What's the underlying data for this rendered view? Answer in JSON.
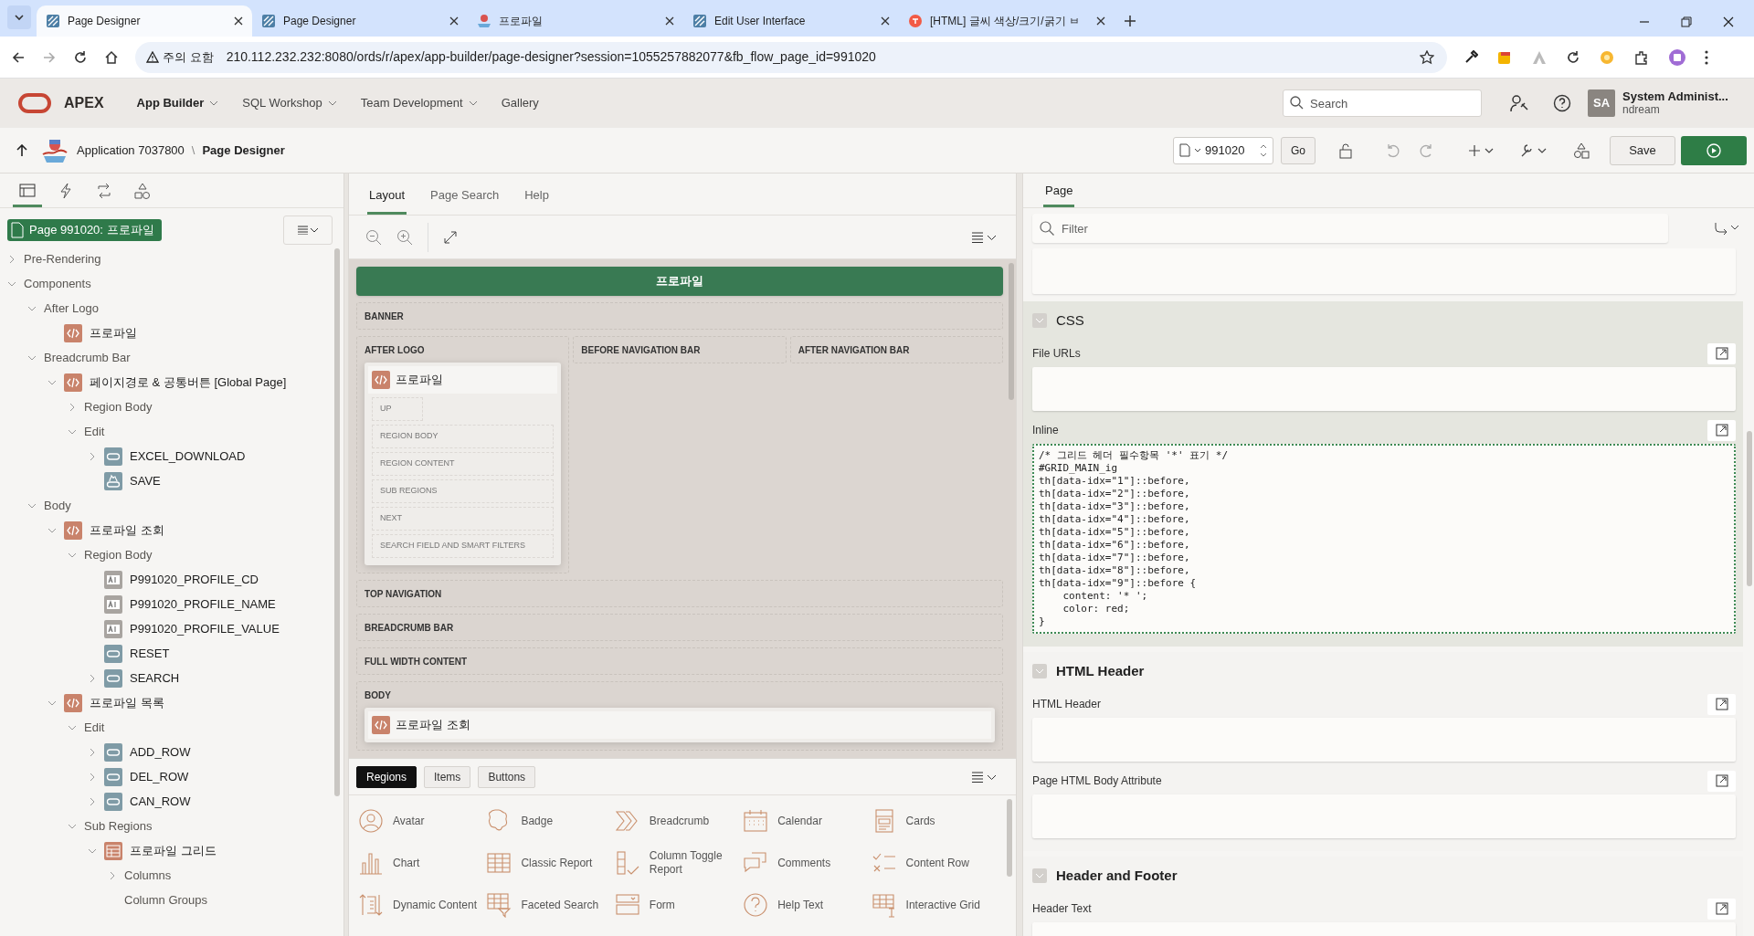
{
  "browser": {
    "tabs": [
      {
        "title": "Page Designer",
        "selected": true,
        "kind": "apex"
      },
      {
        "title": "Page Designer",
        "selected": false,
        "kind": "apex"
      },
      {
        "title": "프로파일",
        "selected": false,
        "kind": "app"
      },
      {
        "title": "Edit User Interface",
        "selected": false,
        "kind": "apex"
      },
      {
        "title": "[HTML] 글씨 색상/크기/굵기 ㅂ",
        "selected": false,
        "kind": "blog"
      }
    ],
    "security_label": "주의 요함",
    "url": "210.112.232.232:8080/ords/r/apex/app-builder/page-designer?session=1055257882077&fb_flow_page_id=991020"
  },
  "app_header": {
    "logo": "APEX",
    "nav": [
      {
        "label": "App Builder",
        "current": true
      },
      {
        "label": "SQL Workshop",
        "current": false
      },
      {
        "label": "Team Development",
        "current": false
      },
      {
        "label": "Gallery",
        "current": false
      }
    ],
    "search": {
      "placeholder": "Search"
    },
    "user": {
      "initials": "SA",
      "name": "System Administ...",
      "workspace": "ndream"
    }
  },
  "toolbar": {
    "application": "Application 7037800",
    "separator": "\\",
    "page_designer": "Page Designer",
    "page_number": "991020",
    "go": "Go",
    "save": "Save"
  },
  "left_panel": {
    "tabs": [
      {
        "selected": true
      },
      {
        "selected": false
      },
      {
        "selected": false
      },
      {
        "selected": false
      }
    ],
    "page_badge": "Page 991020: 프로파일",
    "tree": [
      {
        "label": "Pre-Rendering",
        "kind": "folder",
        "expanded": false
      },
      {
        "label": "Components",
        "kind": "folder",
        "expanded": true,
        "children": [
          {
            "label": "After Logo",
            "kind": "folder",
            "expanded": true,
            "children": [
              {
                "label": "프로파일",
                "kind": "region"
              }
            ]
          },
          {
            "label": "Breadcrumb Bar",
            "kind": "folder",
            "expanded": true,
            "children": [
              {
                "label": "페이지경로 & 공통버튼 [Global Page]",
                "kind": "region",
                "expanded": true,
                "children": [
                  {
                    "label": "Region Body",
                    "kind": "folder",
                    "expanded": false
                  },
                  {
                    "label": "Edit",
                    "kind": "folder",
                    "expanded": true,
                    "children": [
                      {
                        "label": "EXCEL_DOWNLOAD",
                        "kind": "button",
                        "expanded": false
                      },
                      {
                        "label": "SAVE",
                        "kind": "hot_button"
                      }
                    ]
                  }
                ]
              }
            ]
          },
          {
            "label": "Body",
            "kind": "folder",
            "expanded": true,
            "children": [
              {
                "label": "프로파일 조회",
                "kind": "region",
                "expanded": true,
                "children": [
                  {
                    "label": "Region Body",
                    "kind": "folder",
                    "expanded": true,
                    "children": [
                      {
                        "label": "P991020_PROFILE_CD",
                        "kind": "item"
                      },
                      {
                        "label": "P991020_PROFILE_NAME",
                        "kind": "item"
                      },
                      {
                        "label": "P991020_PROFILE_VALUE",
                        "kind": "item"
                      },
                      {
                        "label": "RESET",
                        "kind": "button"
                      },
                      {
                        "label": "SEARCH",
                        "kind": "button",
                        "expanded": false
                      }
                    ]
                  }
                ]
              },
              {
                "label": "프로파일 목록",
                "kind": "region",
                "expanded": true,
                "children": [
                  {
                    "label": "Edit",
                    "kind": "folder",
                    "expanded": true,
                    "children": [
                      {
                        "label": "ADD_ROW",
                        "kind": "button",
                        "expanded": false
                      },
                      {
                        "label": "DEL_ROW",
                        "kind": "button",
                        "expanded": false
                      },
                      {
                        "label": "CAN_ROW",
                        "kind": "button",
                        "expanded": false
                      }
                    ]
                  },
                  {
                    "label": "Sub Regions",
                    "kind": "folder",
                    "expanded": true,
                    "children": [
                      {
                        "label": "프로파일 그리드",
                        "kind": "grid",
                        "expanded": true,
                        "children": [
                          {
                            "label": "Columns",
                            "kind": "folder",
                            "expanded": false
                          },
                          {
                            "label": "Column Groups",
                            "kind": "folder"
                          }
                        ]
                      }
                    ]
                  }
                ]
              }
            ]
          }
        ]
      }
    ]
  },
  "layout_panel": {
    "tabs": [
      {
        "label": "Layout",
        "selected": true
      },
      {
        "label": "Page Search",
        "selected": false
      },
      {
        "label": "Help",
        "selected": false
      }
    ],
    "page_title": "프로파일",
    "positions": [
      {
        "kind": "full",
        "label": "BANNER"
      },
      {
        "kind": "row",
        "columns": [
          {
            "label": "AFTER LOGO",
            "region": {
              "title": "프로파일",
              "slots": [
                "UP",
                "REGION BODY",
                "REGION CONTENT",
                "SUB REGIONS",
                "NEXT",
                "SEARCH FIELD AND SMART FILTERS"
              ]
            }
          },
          {
            "label": "BEFORE NAVIGATION BAR"
          },
          {
            "label": "AFTER NAVIGATION BAR"
          }
        ]
      },
      {
        "kind": "full",
        "label": "TOP NAVIGATION"
      },
      {
        "kind": "full",
        "label": "BREADCRUMB BAR"
      },
      {
        "kind": "full",
        "label": "FULL WIDTH CONTENT"
      },
      {
        "kind": "full",
        "label": "BODY",
        "region": {
          "title": "프로파일 조회"
        }
      }
    ]
  },
  "gallery": {
    "tabs": [
      {
        "label": "Regions",
        "selected": true
      },
      {
        "label": "Items",
        "selected": false
      },
      {
        "label": "Buttons",
        "selected": false
      }
    ],
    "items": [
      "Avatar",
      "Badge",
      "Breadcrumb",
      "Calendar",
      "Cards",
      "Chart",
      "Classic Report",
      "Column Toggle Report",
      "Comments",
      "Content Row",
      "Dynamic Content",
      "Faceted Search",
      "Form",
      "Help Text",
      "Interactive Grid"
    ]
  },
  "property_panel": {
    "tabs": [
      {
        "label": "Page",
        "selected": true
      }
    ],
    "filter": {
      "placeholder": "Filter"
    },
    "groups": [
      {
        "title": "CSS",
        "expanded": true,
        "highlighted": true,
        "fields": [
          {
            "label": "File URLs",
            "focused": false
          },
          {
            "label": "Inline",
            "focused": true,
            "value": "/* 그리드 헤더 필수항목 '*' 표기 */\n#GRID_MAIN_ig\nth[data-idx=\"1\"]::before,\nth[data-idx=\"2\"]::before,\nth[data-idx=\"3\"]::before,\nth[data-idx=\"4\"]::before,\nth[data-idx=\"5\"]::before,\nth[data-idx=\"6\"]::before,\nth[data-idx=\"7\"]::before,\nth[data-idx=\"8\"]::before,\nth[data-idx=\"9\"]::before {\n    content: '* ';\n    color: red;\n}"
          }
        ]
      },
      {
        "title": "HTML Header",
        "expanded": true,
        "highlighted": false,
        "fields": [
          {
            "label": "HTML Header",
            "focused": false
          },
          {
            "label": "Page HTML Body Attribute",
            "focused": false
          }
        ]
      },
      {
        "title": "Header and Footer",
        "expanded": true,
        "highlighted": false,
        "fields": [
          {
            "label": "Header Text",
            "focused": false
          }
        ]
      }
    ]
  }
}
